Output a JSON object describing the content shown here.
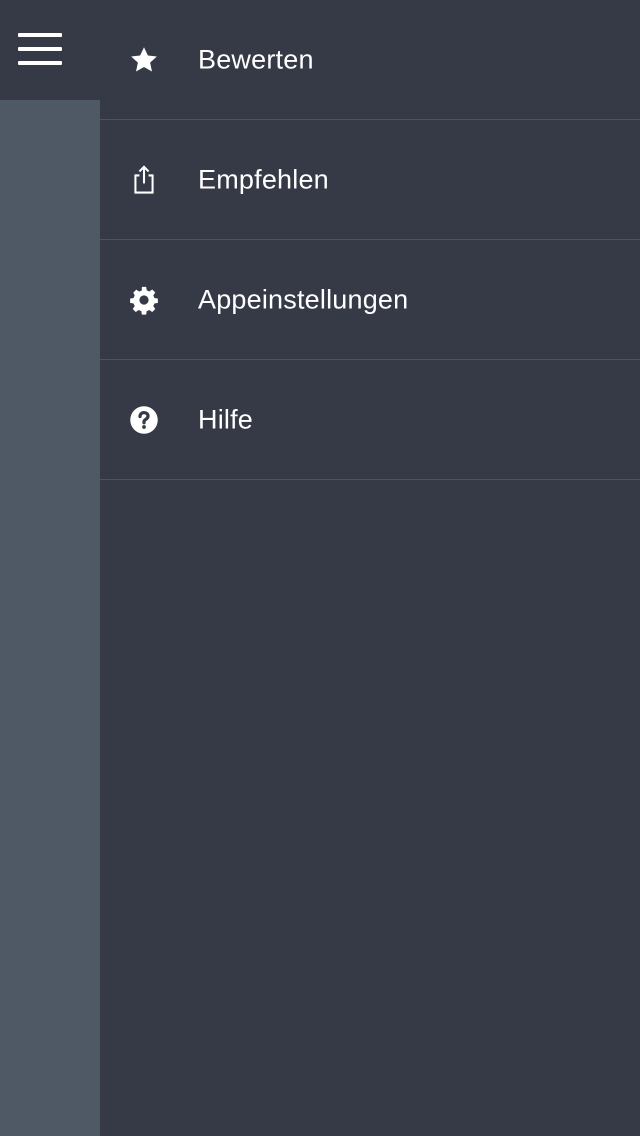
{
  "toolbar": {
    "menu_icon": "hamburger-menu-icon"
  },
  "menu": {
    "items": [
      {
        "label": "Bewerten",
        "icon": "star-icon"
      },
      {
        "label": "Empfehlen",
        "icon": "share-icon"
      },
      {
        "label": "Appeinstellungen",
        "icon": "gear-icon"
      },
      {
        "label": "Hilfe",
        "icon": "help-icon"
      }
    ]
  },
  "colors": {
    "panel_background": "#353a46",
    "dimmed_content": "#4f5965",
    "divider": "#4d535e",
    "text": "#ffffff"
  }
}
